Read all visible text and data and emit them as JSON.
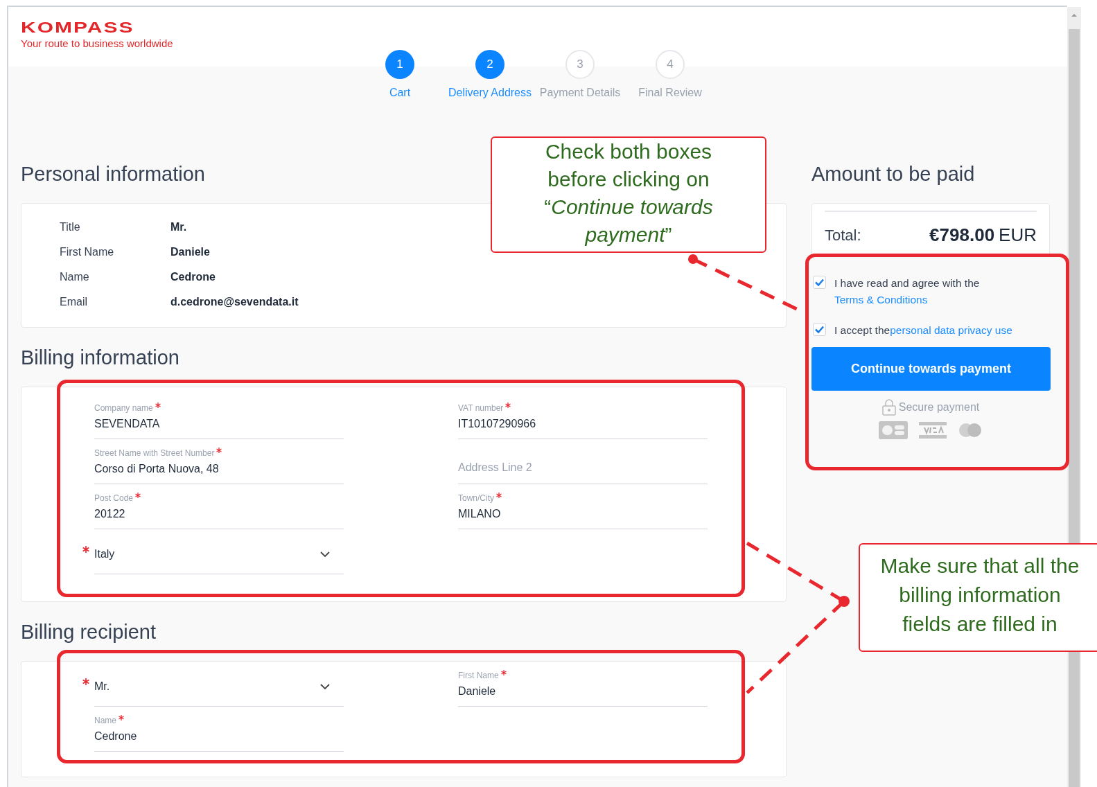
{
  "logo": {
    "wordmark": "KOMPASS",
    "tagline": "Your route to business worldwide"
  },
  "steps": [
    {
      "number": "1",
      "label": "Cart",
      "active": true
    },
    {
      "number": "2",
      "label": "Delivery Address",
      "active": true
    },
    {
      "number": "3",
      "label": "Payment Details",
      "active": false
    },
    {
      "number": "4",
      "label": "Final Review",
      "active": false
    }
  ],
  "personal_information": {
    "title": "Personal information",
    "rows": [
      {
        "label": "Title",
        "value": "Mr."
      },
      {
        "label": "First Name",
        "value": "Daniele"
      },
      {
        "label": "Name",
        "value": "Cedrone"
      },
      {
        "label": "Email",
        "value": "d.cedrone@sevendata.it"
      }
    ]
  },
  "billing_information": {
    "title": "Billing information",
    "fields": [
      {
        "kind": "text",
        "label": "Company name",
        "value": "SEVENDATA",
        "required": true
      },
      {
        "kind": "text",
        "label": "VAT number",
        "value": "IT10107290966",
        "required": true
      },
      {
        "kind": "text",
        "label": "Street Name with Street Number",
        "value": "Corso di Porta Nuova, 48",
        "required": true
      },
      {
        "kind": "empty",
        "placeholder": "Address Line 2",
        "required": false
      },
      {
        "kind": "text",
        "label": "Post Code",
        "value": "20122",
        "required": true
      },
      {
        "kind": "text",
        "label": "Town/City",
        "value": "MILANO",
        "required": true
      },
      {
        "kind": "select",
        "value": "Italy",
        "required": true
      }
    ]
  },
  "billing_recipient": {
    "title": "Billing recipient",
    "fields": [
      {
        "kind": "select",
        "value": "Mr.",
        "required": true
      },
      {
        "kind": "text",
        "label": "First Name",
        "value": "Daniele",
        "required": true
      },
      {
        "kind": "text",
        "label": "Name",
        "value": "Cedrone",
        "required": true
      }
    ]
  },
  "summary": {
    "title": "Amount to be paid",
    "total_label": "Total:",
    "amount": "€798.00",
    "currency": "EUR",
    "agreements": [
      {
        "text": "I have read and agree with the ",
        "link": "Terms & Conditions",
        "checked": true
      },
      {
        "text": "I accept the",
        "link": "personal data privacy use",
        "checked": true
      }
    ],
    "button": "Continue towards payment",
    "secure_label": "Secure payment"
  },
  "annotations": [
    {
      "text": "Check both boxes before clicking on “*Continue towards payment*”"
    },
    {
      "text": "Make sure that all the billing information fields are filled in"
    }
  ]
}
